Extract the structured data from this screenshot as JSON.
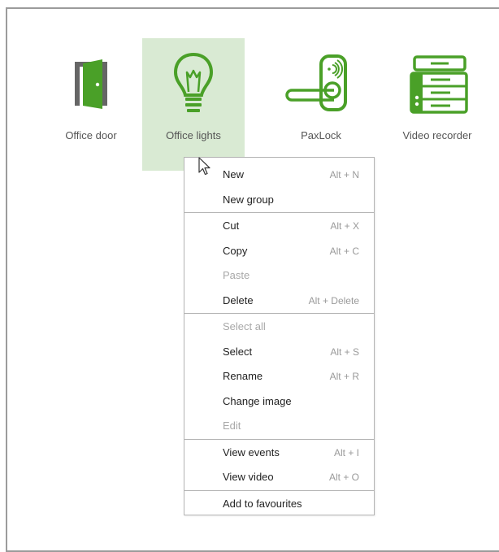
{
  "devices": [
    {
      "label": "Office door",
      "icon": "door-icon",
      "selected": false
    },
    {
      "label": "Office lights",
      "icon": "lightbulb-icon",
      "selected": true
    },
    {
      "label": "PaxLock",
      "icon": "paxlock-icon",
      "selected": false
    },
    {
      "label": "Video recorder",
      "icon": "video-recorder-icon",
      "selected": false
    }
  ],
  "colors": {
    "accent_green": "#4aa028",
    "door_frame": "#666666",
    "selection_bg": "#d9ead3",
    "disabled_text": "#a8a8a8",
    "shortcut_text": "#9a9a9a"
  },
  "context_menu": {
    "groups": [
      [
        {
          "label": "New",
          "shortcut": "Alt + N",
          "enabled": true
        },
        {
          "label": "New group",
          "shortcut": "",
          "enabled": true
        }
      ],
      [
        {
          "label": "Cut",
          "shortcut": "Alt + X",
          "enabled": true
        },
        {
          "label": "Copy",
          "shortcut": "Alt + C",
          "enabled": true
        },
        {
          "label": "Paste",
          "shortcut": "",
          "enabled": false
        },
        {
          "label": "Delete",
          "shortcut": "Alt + Delete",
          "enabled": true
        }
      ],
      [
        {
          "label": "Select all",
          "shortcut": "",
          "enabled": false
        },
        {
          "label": "Select",
          "shortcut": "Alt + S",
          "enabled": true
        },
        {
          "label": "Rename",
          "shortcut": "Alt + R",
          "enabled": true
        },
        {
          "label": "Change image",
          "shortcut": "",
          "enabled": true
        },
        {
          "label": "Edit",
          "shortcut": "",
          "enabled": false
        }
      ],
      [
        {
          "label": "View events",
          "shortcut": "Alt + I",
          "enabled": true
        },
        {
          "label": "View video",
          "shortcut": "Alt + O",
          "enabled": true
        }
      ],
      [
        {
          "label": "Add to favourites",
          "shortcut": "",
          "enabled": true
        }
      ]
    ]
  }
}
